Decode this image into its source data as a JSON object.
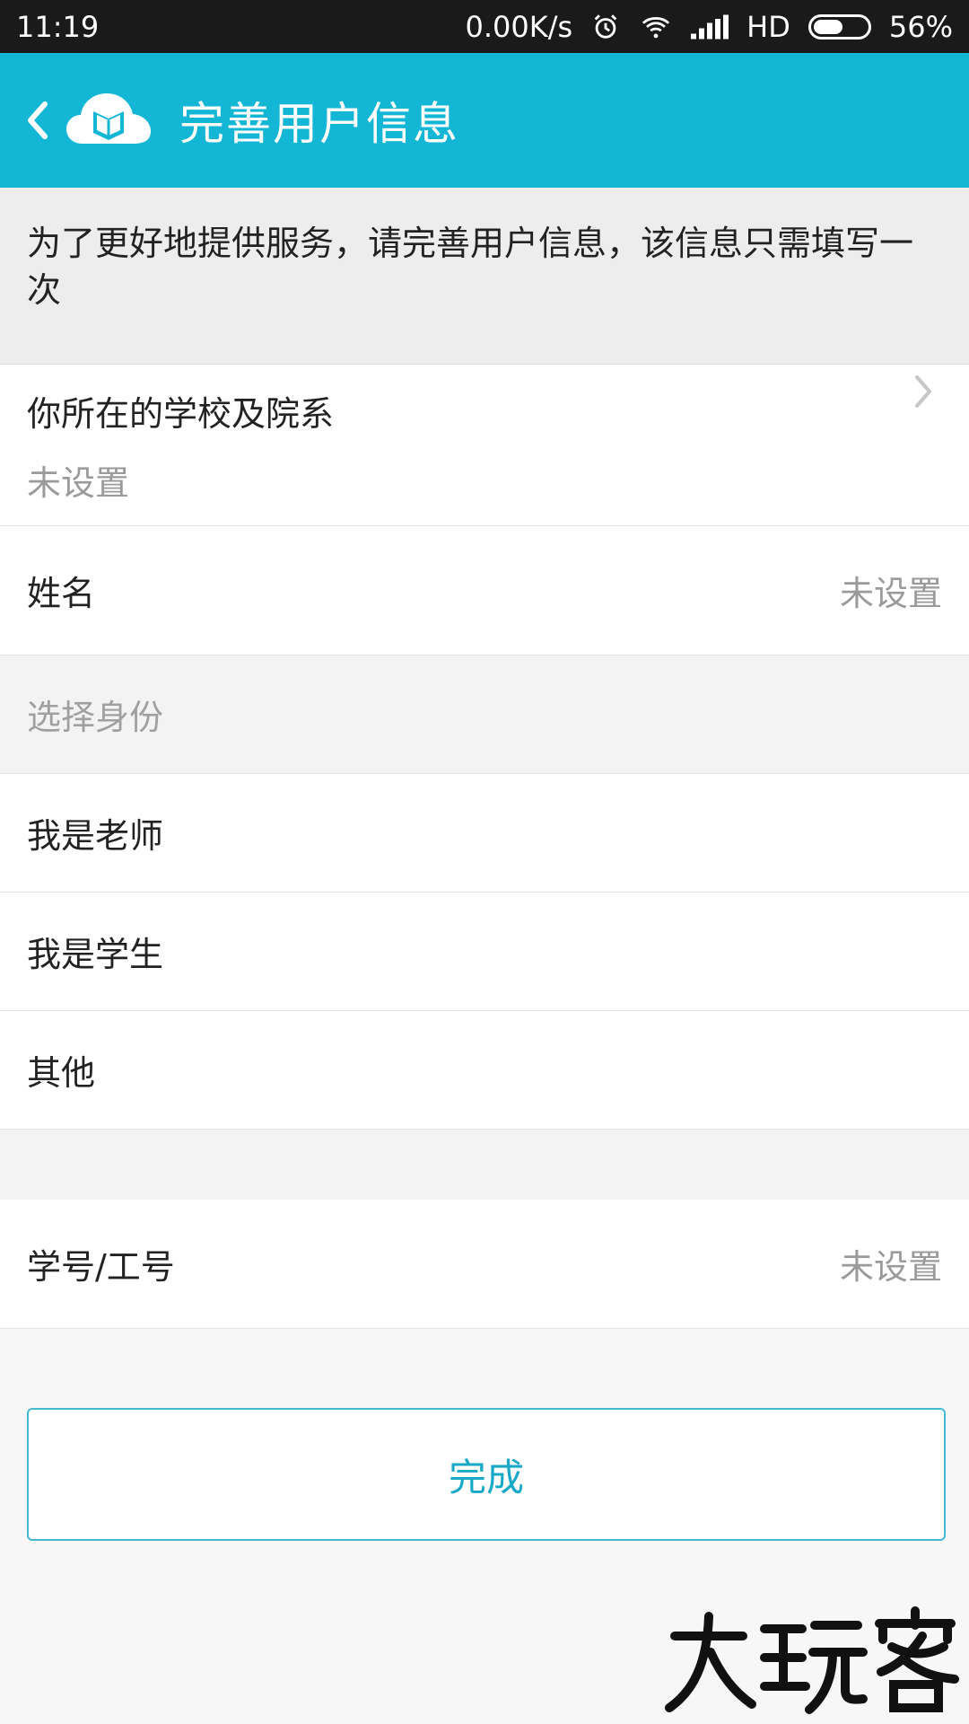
{
  "status_bar": {
    "time": "11:19",
    "network_speed": "0.00K/s",
    "hd_label": "HD",
    "battery_text": "56%",
    "battery_level": 0.56,
    "icons": [
      "alarm-icon",
      "wifi-icon",
      "signal-icon",
      "battery-icon"
    ]
  },
  "header": {
    "title": "完善用户信息",
    "colors": {
      "background": "#13b6d5",
      "text": "#ffffff"
    }
  },
  "intro": {
    "message": "为了更好地提供服务，请完善用户信息，该信息只需填写一次"
  },
  "profile": {
    "school": {
      "label": "你所在的学校及院系",
      "value": "未设置"
    },
    "name": {
      "label": "姓名",
      "value": "未设置"
    },
    "identity": {
      "header": "选择身份",
      "options": [
        {
          "label": "我是老师"
        },
        {
          "label": "我是学生"
        },
        {
          "label": "其他"
        }
      ]
    },
    "id_number": {
      "label": "学号/工号",
      "value": "未设置"
    }
  },
  "actions": {
    "complete_label": "完成",
    "accent_color": "#18a9c9"
  },
  "watermark": {
    "text": "大玩客"
  }
}
